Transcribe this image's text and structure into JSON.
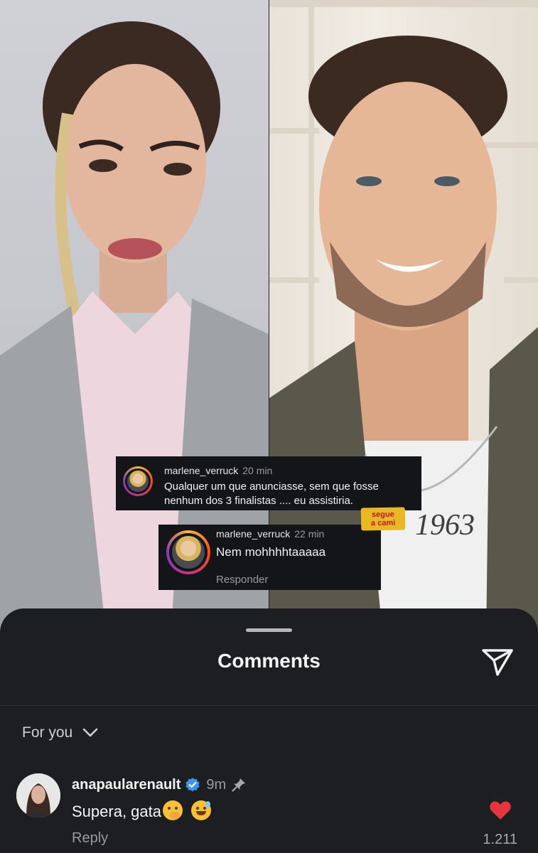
{
  "overlay_comments": [
    {
      "username": "marlene_verruck",
      "time": "20 min",
      "text_line1": "Qualquer um que anunciasse, sem que fosse",
      "text_line2": "nenhum dos 3 finalistas .... eu assistiria."
    },
    {
      "username": "marlene_verruck",
      "time": "22 min",
      "text_line1": "Nem mohhhhtaaaaa",
      "reply_label": "Responder"
    }
  ],
  "badge": {
    "line1": "segue",
    "line2": "a cami"
  },
  "sheet": {
    "title": "Comments",
    "filter_label": "For you"
  },
  "comment": {
    "username": "anapaularenault",
    "time": "9m",
    "text": "Supera, gata",
    "reply_label": "Reply",
    "likes": "1.211"
  },
  "colors": {
    "accent_like": "#e8343f",
    "verified": "#3897f0",
    "badge": "#e9b824"
  }
}
